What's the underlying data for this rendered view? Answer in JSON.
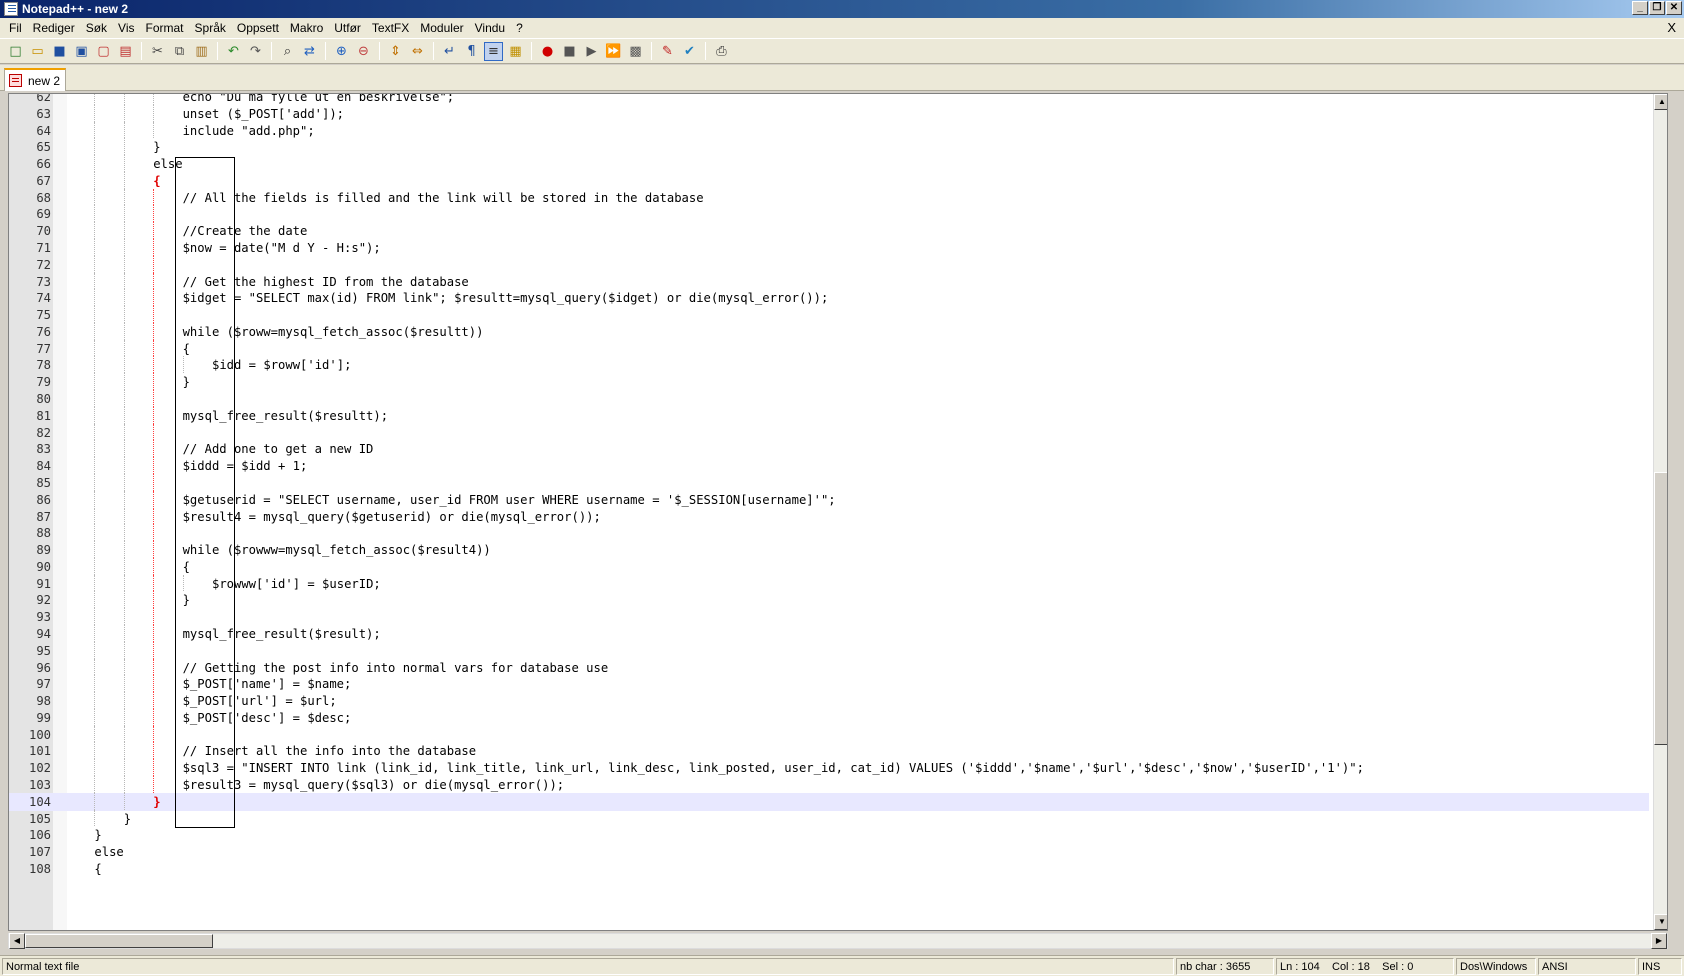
{
  "window": {
    "title": "Notepad++ - new 2",
    "minimize_glyph": "_",
    "restore_glyph": "❐",
    "close_glyph": "✕"
  },
  "menu": {
    "items": [
      "Fil",
      "Rediger",
      "Søk",
      "Vis",
      "Format",
      "Språk",
      "Oppsett",
      "Makro",
      "Utfør",
      "TextFX",
      "Moduler",
      "Vindu",
      "?"
    ],
    "close_glyph": "X"
  },
  "toolbar": {
    "icons": [
      "new-file-icon",
      "open-file-icon",
      "save-icon",
      "save-all-icon",
      "close-icon",
      "close-all-icon",
      "cut-icon",
      "copy-icon",
      "paste-icon",
      "undo-icon",
      "redo-icon",
      "find-icon",
      "replace-icon",
      "zoom-in-icon",
      "zoom-out-icon",
      "sync-vertical-icon",
      "sync-horizontal-icon",
      "word-wrap-icon",
      "show-all-chars-icon",
      "indent-guide-icon",
      "user-define-icon",
      "record-macro-icon",
      "stop-macro-icon",
      "play-macro-icon",
      "run-macro-multiple-icon",
      "save-macro-icon",
      "tidy-icon",
      "spell-check-icon",
      "print-icon"
    ]
  },
  "tabs": [
    {
      "label": "new 2",
      "active": true
    }
  ],
  "editor": {
    "first_line": 62,
    "current_line": 104,
    "lines": [
      {
        "n": "62",
        "text": "echo \"Du må fylle ut en beskrivelse\";",
        "indent": 4
      },
      {
        "n": "63",
        "text": "unset ($_POST['add']);",
        "indent": 4
      },
      {
        "n": "64",
        "text": "include \"add.php\";",
        "indent": 4
      },
      {
        "n": "65",
        "text": "}",
        "indent": 3
      },
      {
        "n": "66",
        "text": "else",
        "indent": 3
      },
      {
        "n": "67",
        "text": "{",
        "indent": 3,
        "red": true
      },
      {
        "n": "68",
        "text": "// All the fields is filled and the link will be stored in the database",
        "indent": 4
      },
      {
        "n": "69",
        "text": "",
        "indent": 4
      },
      {
        "n": "70",
        "text": "//Create the date",
        "indent": 4
      },
      {
        "n": "71",
        "text": "$now = date(\"M d Y - H:s\");",
        "indent": 4
      },
      {
        "n": "72",
        "text": "",
        "indent": 4
      },
      {
        "n": "73",
        "text": "// Get the highest ID from the database",
        "indent": 4
      },
      {
        "n": "74",
        "text": "$idget = \"SELECT max(id) FROM link\"; $resultt=mysql_query($idget) or die(mysql_error());",
        "indent": 4
      },
      {
        "n": "75",
        "text": "",
        "indent": 4
      },
      {
        "n": "76",
        "text": "while ($roww=mysql_fetch_assoc($resultt))",
        "indent": 4
      },
      {
        "n": "77",
        "text": "{",
        "indent": 4
      },
      {
        "n": "78",
        "text": "$idd = $roww['id'];",
        "indent": 5
      },
      {
        "n": "79",
        "text": "}",
        "indent": 4
      },
      {
        "n": "80",
        "text": "",
        "indent": 4
      },
      {
        "n": "81",
        "text": "mysql_free_result($resultt);",
        "indent": 4
      },
      {
        "n": "82",
        "text": "",
        "indent": 4
      },
      {
        "n": "83",
        "text": "// Add one to get a new ID",
        "indent": 4
      },
      {
        "n": "84",
        "text": "$iddd = $idd + 1;",
        "indent": 4
      },
      {
        "n": "85",
        "text": "",
        "indent": 4
      },
      {
        "n": "86",
        "text": "$getuserid = \"SELECT username, user_id FROM user WHERE username = '$_SESSION[username]'\";",
        "indent": 4
      },
      {
        "n": "87",
        "text": "$result4 = mysql_query($getuserid) or die(mysql_error());",
        "indent": 4
      },
      {
        "n": "88",
        "text": "",
        "indent": 4
      },
      {
        "n": "89",
        "text": "while ($rowww=mysql_fetch_assoc($result4))",
        "indent": 4
      },
      {
        "n": "90",
        "text": "{",
        "indent": 4
      },
      {
        "n": "91",
        "text": "$rowww['id'] = $userID;",
        "indent": 5
      },
      {
        "n": "92",
        "text": "}",
        "indent": 4
      },
      {
        "n": "93",
        "text": "",
        "indent": 4
      },
      {
        "n": "94",
        "text": "mysql_free_result($result);",
        "indent": 4
      },
      {
        "n": "95",
        "text": "",
        "indent": 4
      },
      {
        "n": "96",
        "text": "// Getting the post info into normal vars for database use",
        "indent": 4
      },
      {
        "n": "97",
        "text": "$_POST['name'] = $name;",
        "indent": 4
      },
      {
        "n": "98",
        "text": "$_POST['url'] = $url;",
        "indent": 4
      },
      {
        "n": "99",
        "text": "$_POST['desc'] = $desc;",
        "indent": 4
      },
      {
        "n": "100",
        "text": "",
        "indent": 4
      },
      {
        "n": "101",
        "text": "// Insert all the info into the database",
        "indent": 4
      },
      {
        "n": "102",
        "text": "$sql3 = \"INSERT INTO link (link_id, link_title, link_url, link_desc, link_posted, user_id, cat_id) VALUES ('$iddd','$name','$url','$desc','$now','$userID','1')\";",
        "indent": 4
      },
      {
        "n": "103",
        "text": "$result3 = mysql_query($sql3) or die(mysql_error());",
        "indent": 4
      },
      {
        "n": "104",
        "text": "}",
        "indent": 3,
        "red": true
      },
      {
        "n": "105",
        "text": "}",
        "indent": 2
      },
      {
        "n": "106",
        "text": "}",
        "indent": 1
      },
      {
        "n": "107",
        "text": "else",
        "indent": 1
      },
      {
        "n": "108",
        "text": "{",
        "indent": 1
      }
    ]
  },
  "statusbar": {
    "file_type": "Normal text file",
    "nb_char": "nb char : 3655",
    "ln": "Ln : 104",
    "col": "Col : 18",
    "sel": "Sel : 0",
    "eol": "Dos\\Windows",
    "encoding": "ANSI",
    "mode": "INS"
  }
}
